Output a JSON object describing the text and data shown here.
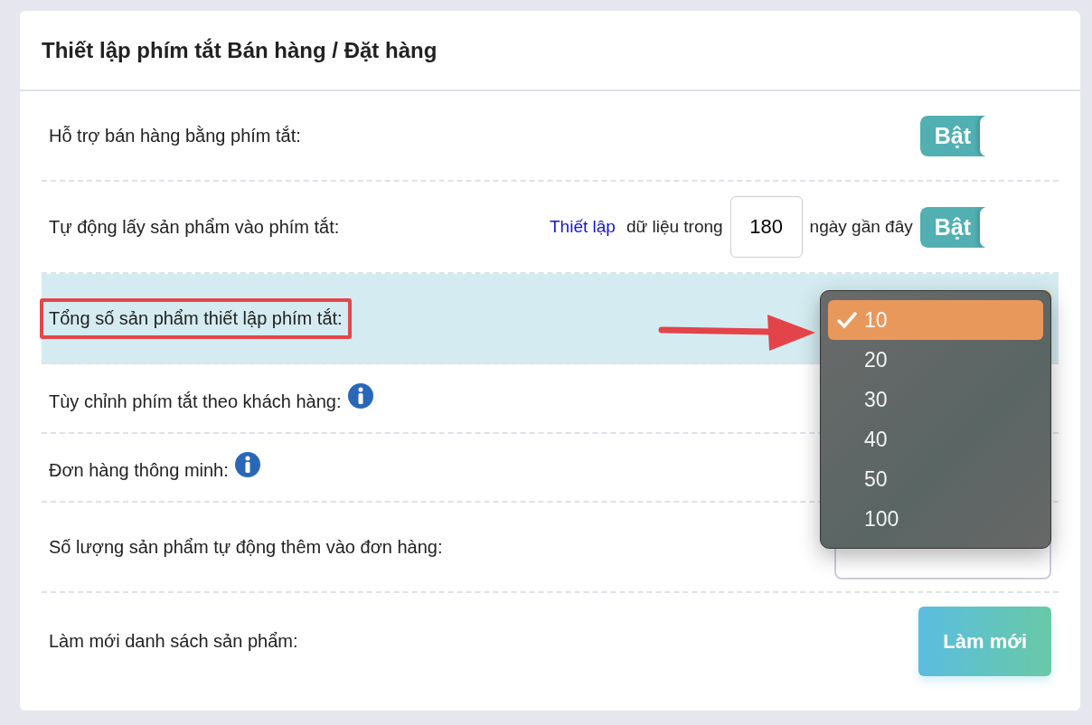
{
  "title": "Thiết lập phím tắt Bán hàng / Đặt hàng",
  "rows": [
    {
      "kind": "toggle",
      "label": "Hỗ trợ bán hàng bằng phím tắt:",
      "toggle": {
        "label": "Bật",
        "on": true
      }
    },
    {
      "kind": "days",
      "label": "Tự động lấy sản phẩm vào phím tắt:",
      "link": "Thiết lập",
      "before": "dữ liệu trong",
      "days": "180",
      "after": "ngày gần đây",
      "toggle": {
        "label": "Bật",
        "on": true
      }
    },
    {
      "kind": "select-open",
      "label": "Tổng số sản phẩm thiết lập phím tắt:",
      "highlighted": true,
      "options": [
        {
          "label": "10",
          "selected": true
        },
        {
          "label": "20",
          "selected": false
        },
        {
          "label": "30",
          "selected": false
        },
        {
          "label": "40",
          "selected": false
        },
        {
          "label": "50",
          "selected": false
        },
        {
          "label": "100",
          "selected": false
        }
      ]
    },
    {
      "kind": "info",
      "label": "Tùy chỉnh phím tắt theo khách hàng:"
    },
    {
      "kind": "info",
      "label": "Đơn hàng thông minh:"
    },
    {
      "kind": "select",
      "label": "Số lượng sản phẩm tự động thêm vào đơn hàng:"
    },
    {
      "kind": "button",
      "label": "Làm mới danh sách sản phẩm:",
      "button": "Làm mới"
    }
  ]
}
